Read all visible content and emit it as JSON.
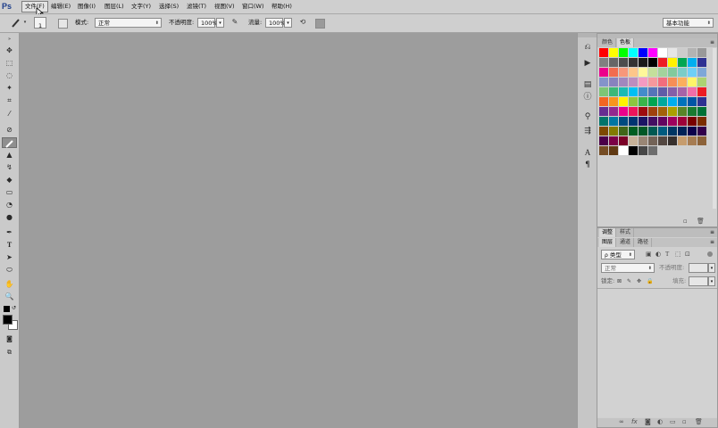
{
  "app": {
    "logo": "Ps"
  },
  "menu": [
    "文件(F)",
    "编辑(E)",
    "图像(I)",
    "图层(L)",
    "文字(Y)",
    "选择(S)",
    "滤镜(T)",
    "视图(V)",
    "窗口(W)",
    "帮助(H)"
  ],
  "options": {
    "brush_size": "1",
    "mode_label": "模式:",
    "mode_value": "正常",
    "opacity_label": "不透明度:",
    "opacity_value": "100%",
    "flow_label": "流量:",
    "flow_value": "100%",
    "workspace": "基本功能"
  },
  "swatches_panel": {
    "tabs": [
      "颜色",
      "色板"
    ],
    "colors": [
      "#ff0000",
      "#ffff00",
      "#00ff00",
      "#00ffff",
      "#0000ff",
      "#ff00ff",
      "#ffffff",
      "#e6e6e6",
      "#cccccc",
      "#b3b3b3",
      "#999999",
      "#808080",
      "#666666",
      "#4d4d4d",
      "#333333",
      "#1a1a1a",
      "#000000",
      "#ed1c24",
      "#fff200",
      "#00a651",
      "#00aeef",
      "#2e3192",
      "#ec008c",
      "#f26c4f",
      "#f7977a",
      "#fdc68a",
      "#fff79a",
      "#c4df9b",
      "#a3d39c",
      "#82ca9d",
      "#7bcdc8",
      "#6ecff6",
      "#7ea7d8",
      "#8493ca",
      "#8882be",
      "#a187be",
      "#bc8dbf",
      "#f49ac2",
      "#f6989d",
      "#f26d7d",
      "#f68e56",
      "#fbaf5d",
      "#fff568",
      "#acd372",
      "#7cc576",
      "#3bb878",
      "#1abbb4",
      "#00bff3",
      "#438ccb",
      "#5574b9",
      "#605ca8",
      "#855fa8",
      "#a763a8",
      "#f06ea9",
      "#ed1c24",
      "#f26522",
      "#f7941d",
      "#fff200",
      "#8dc73f",
      "#39b54a",
      "#00a651",
      "#00a99d",
      "#00aeef",
      "#0072bc",
      "#0054a6",
      "#2e3192",
      "#662d91",
      "#92278f",
      "#ec008c",
      "#ed145b",
      "#9e0b0f",
      "#a0410d",
      "#a36209",
      "#aba000",
      "#598527",
      "#197b30",
      "#007236",
      "#00746b",
      "#0076a3",
      "#004a80",
      "#003471",
      "#1b1464",
      "#440e62",
      "#630460",
      "#9e005d",
      "#9e0039",
      "#790000",
      "#7b2e00",
      "#7d4900",
      "#827b00",
      "#406618",
      "#005e20",
      "#005826",
      "#005952",
      "#005b7f",
      "#003663",
      "#002157",
      "#0d004c",
      "#32004b",
      "#4b0049",
      "#7b0046",
      "#7a0026",
      "#c7b299",
      "#998675",
      "#736357",
      "#534741",
      "#37302d",
      "#c69c6d",
      "#a67c52",
      "#8c6239",
      "#754c24",
      "#603913",
      "#ffffff",
      "#000000",
      "#464646",
      "#6d6d6d"
    ]
  },
  "adjust_panel": {
    "tabs": [
      "调整",
      "样式"
    ]
  },
  "layers_panel": {
    "tabs": [
      "图层",
      "通道",
      "路径"
    ],
    "kind_label": "类型",
    "blend_mode": "正常",
    "opacity_label": "不透明度:",
    "lock_label": "锁定:",
    "fill_label": "填充:"
  }
}
